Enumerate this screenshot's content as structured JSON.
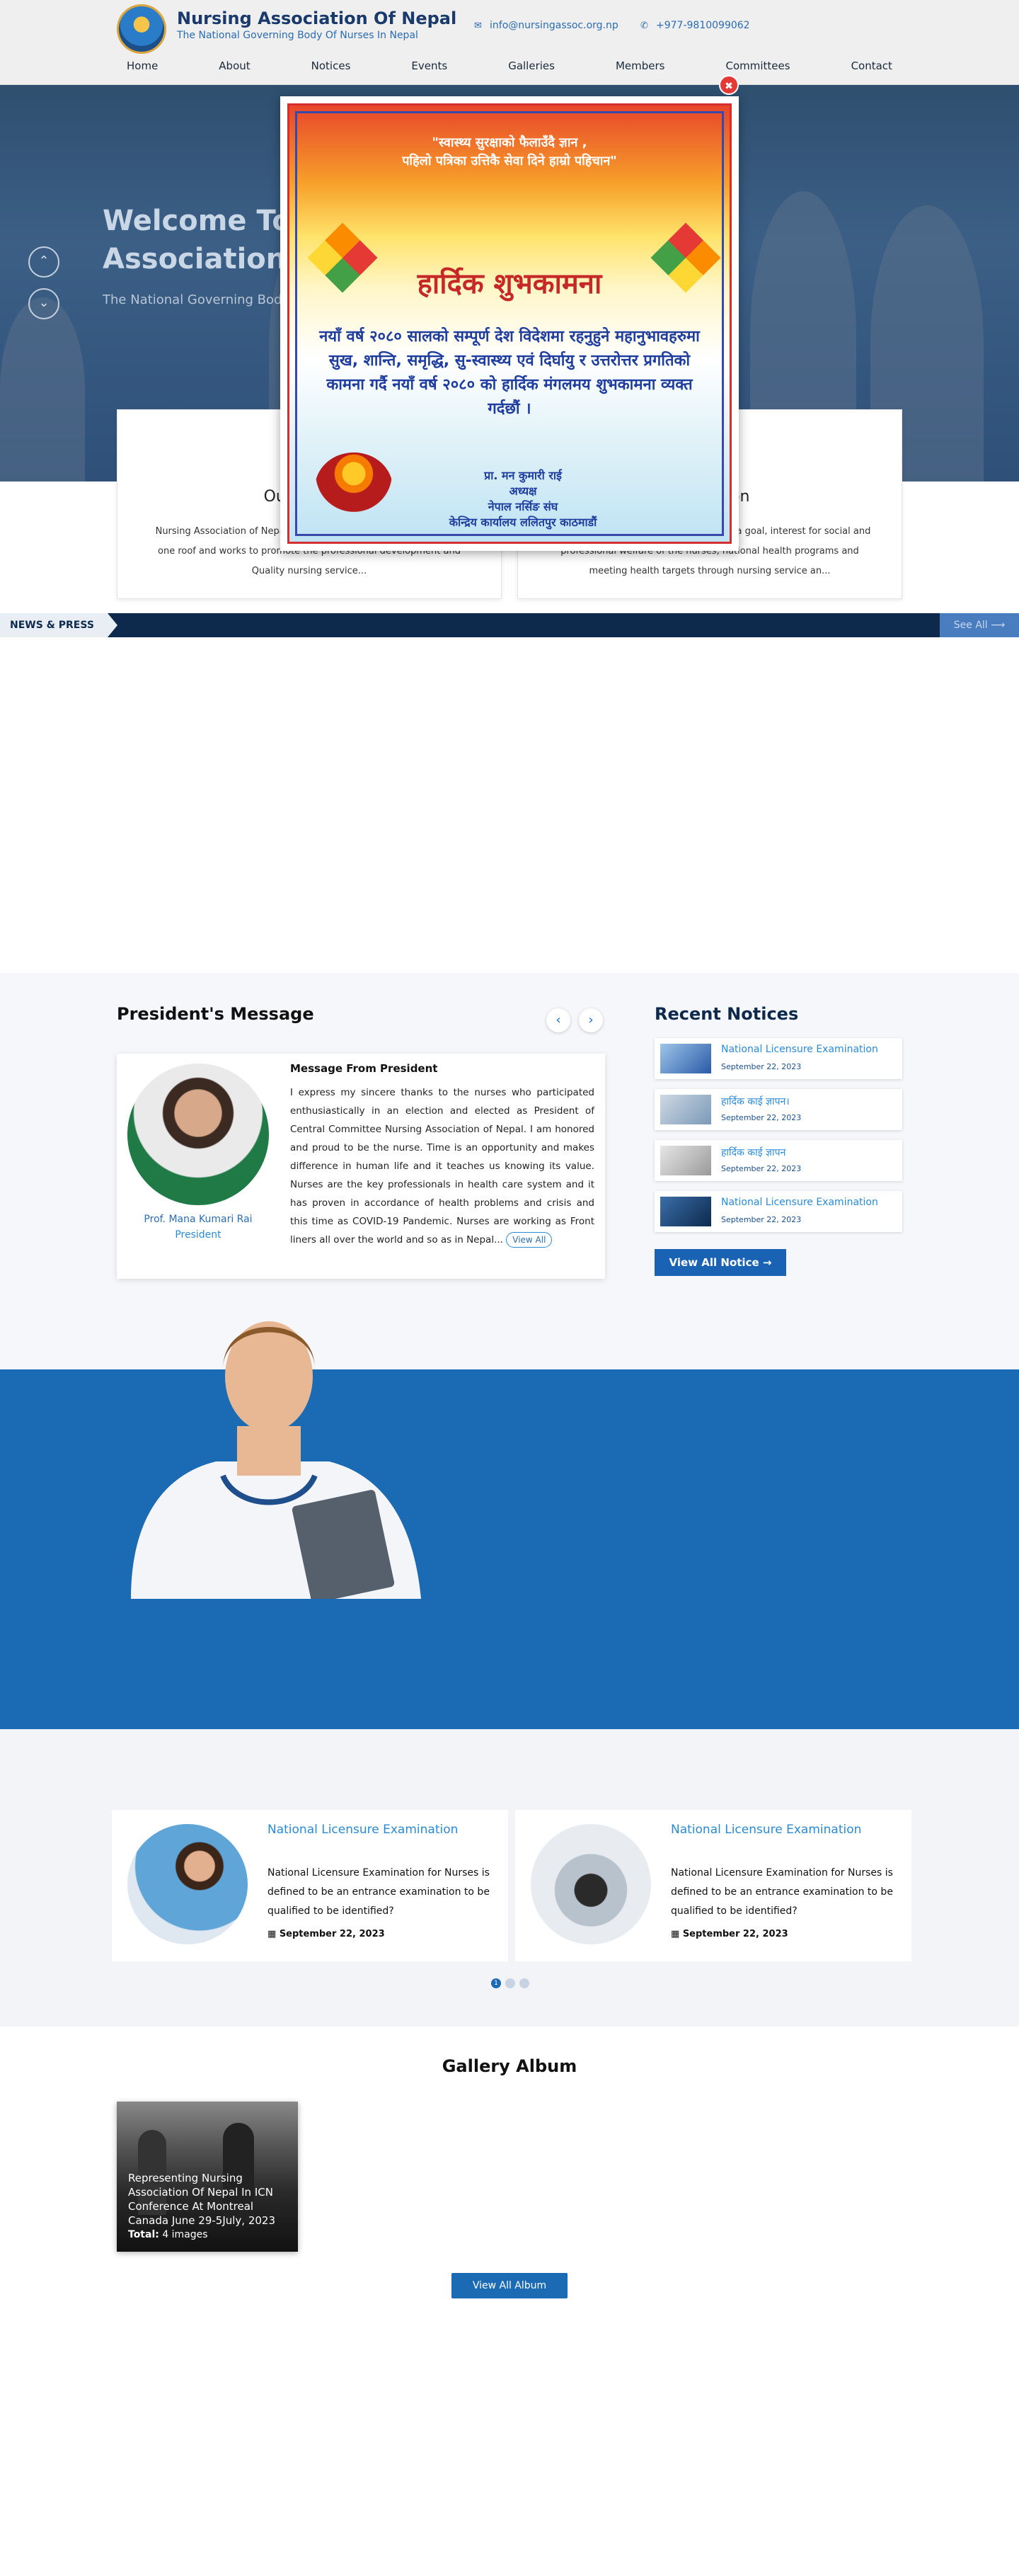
{
  "brand": {
    "title": "Nursing Association Of Nepal",
    "subtitle": "The National Governing Body Of Nurses In Nepal"
  },
  "contact": {
    "email": "info@nursingassoc.org.np",
    "phone": "+977-9810099062"
  },
  "nav": [
    "Home",
    "About",
    "Notices",
    "Events",
    "Galleries",
    "Members",
    "Committees",
    "Contact"
  ],
  "hero": {
    "title": "Welcome To Nursing Association Of Nepal",
    "subtitle": "The National Governing Body Of Nurses In Nepal"
  },
  "overview_cards": [
    {
      "title": "Our Mission",
      "text": "Nursing Association of Nepal unites all nursing professionals under one roof and works to promote the professional development and Quality nursing service..."
    },
    {
      "title": "Our Vision",
      "text": "Nursing Association of Nepal works with a goal, interest for social and professional welfare of the nurses, national health programs and meeting health targets through nursing service an..."
    }
  ],
  "newsbar": {
    "label": "NEWS & PRESS",
    "see_all": "See All ⟶"
  },
  "popup": {
    "line1": "\"स्वास्थ्य सुरक्षाको फैलाउँदै ज्ञान ,",
    "line2": "पहिलो पत्रिका उत्तिकै सेवा दिने हाम्रो पहिचान\"",
    "heading": "हार्दिक शुभकामना",
    "body": "नयाँ वर्ष २०८० सालको सम्पूर्ण देश विदेशमा रहनुहुने महानुभावहरुमा सुख, शान्ति, समृद्धि, सु-स्वास्थ्य एवं दिर्घायु र उत्तरोत्तर प्रगतिको कामना गर्दै नयाँ वर्ष २०८० को हार्दिक मंगलमय शुभकामना व्यक्त गर्दछौं ।",
    "signature": "प्रा. मन कुमारी राई\nअध्यक्ष\nनेपाल नर्सिङ संघ\nकेन्द्रिय कार्यालय ललितपुर काठमाडौं",
    "close": "✖"
  },
  "president": {
    "section_title": "President's Message",
    "name": "Prof. Mana Kumari Rai",
    "role": "President",
    "heading": "Message From President",
    "message": "I express my sincere thanks to the nurses who participated enthusiastically in an election and elected as President of Central Committee Nursing Association of Nepal. I am honored and proud to be the nurse. Time is an opportunity and makes difference in human life and it teaches us knowing its value. Nurses are the key professionals in health care system and it has proven in accordance of health problems and crisis and this time as COVID-19 Pandemic. Nurses are working as Front liners all over the world and so as in Nepal...",
    "view_all": "View All",
    "prev": "‹",
    "next": "›"
  },
  "recent_notices": {
    "title": "Recent Notices",
    "items": [
      {
        "title": "National Licensure Examination",
        "date": "September 22, 2023"
      },
      {
        "title": "हार्दिक काई ज्ञापन।",
        "date": "September 22, 2023"
      },
      {
        "title": "हार्दिक काई ज्ञापन",
        "date": "September 22, 2023"
      },
      {
        "title": "National Licensure Examination",
        "date": "September 22, 2023"
      }
    ],
    "button": "View All Notice →"
  },
  "notice_cards": [
    {
      "title": "National Licensure Examination",
      "text": "National Licensure Examination for Nurses is defined to be an entrance examination to be qualified to be identified?",
      "date": "September 22, 2023"
    },
    {
      "title": "National Licensure Examination",
      "text": "National Licensure Examination for Nurses is defined to be an entrance examination to be qualified to be identified?",
      "date": "September 22, 2023"
    }
  ],
  "pagination": {
    "count": 3,
    "active": 1,
    "active_label": "1"
  },
  "gallery": {
    "title": "Gallery Album",
    "album_caption": "Representing Nursing Association Of Nepal In ICN Conference At Montreal Canada June 29-5July, 2023",
    "total_label": "Total:",
    "total_value": "4 images",
    "button": "View All Album"
  },
  "colors": {
    "primary": "#1a6ab4",
    "navy": "#0d2a4d",
    "link": "#2b8ad6"
  },
  "icons": {
    "email": "envelope-icon",
    "phone": "phone-icon",
    "calendar": "calendar-icon"
  }
}
